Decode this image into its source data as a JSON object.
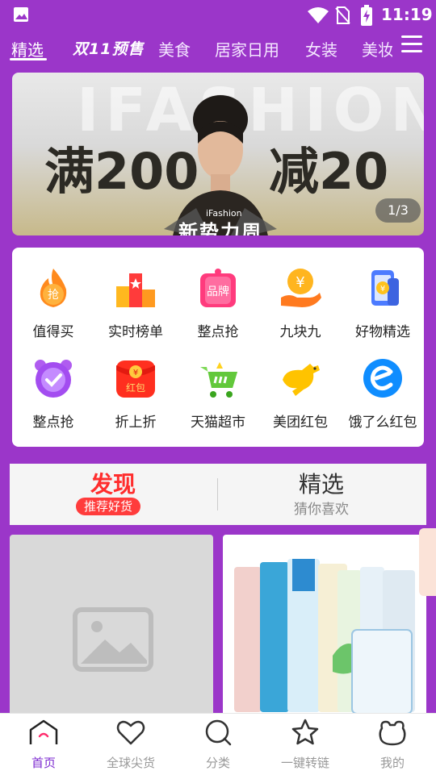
{
  "status_bar": {
    "time": "11:19"
  },
  "top_tabs": [
    {
      "label": "精选"
    },
    {
      "label": "双11预售"
    },
    {
      "label": "美食"
    },
    {
      "label": "居家日用"
    },
    {
      "label": "女装"
    },
    {
      "label": "美妆"
    }
  ],
  "banner": {
    "bg_text": "IFASHION",
    "left_text": "满200",
    "right_text": "减20",
    "small_brand": "iFashion",
    "sub_text": "新势力周",
    "pager": "1/3"
  },
  "grid_items": [
    {
      "label": "值得买",
      "icon": "flame-grab-icon"
    },
    {
      "label": "实时榜单",
      "icon": "podium-icon"
    },
    {
      "label": "整点抢",
      "icon": "brand-tag-icon"
    },
    {
      "label": "九块九",
      "icon": "yen-coin-hand-icon"
    },
    {
      "label": "好物精选",
      "icon": "phone-coin-icon"
    },
    {
      "label": "整点抢",
      "icon": "alarm-check-icon"
    },
    {
      "label": "折上折",
      "icon": "red-packet-icon"
    },
    {
      "label": "天猫超市",
      "icon": "shopping-cart-icon"
    },
    {
      "label": "美团红包",
      "icon": "kangaroo-icon"
    },
    {
      "label": "饿了么红包",
      "icon": "eleme-icon"
    }
  ],
  "discover": {
    "left_title": "发现",
    "left_badge": "推荐好货",
    "right_title": "精选",
    "right_sub": "猜你喜欢"
  },
  "bottom_nav": [
    {
      "label": "首页",
      "active": true
    },
    {
      "label": "全球尖货"
    },
    {
      "label": "分类"
    },
    {
      "label": "一键转链"
    },
    {
      "label": "我的"
    }
  ],
  "colors": {
    "primary": "#9b36c9",
    "accent_red": "#ff2d2d",
    "active_nav": "#7d2bd0"
  }
}
